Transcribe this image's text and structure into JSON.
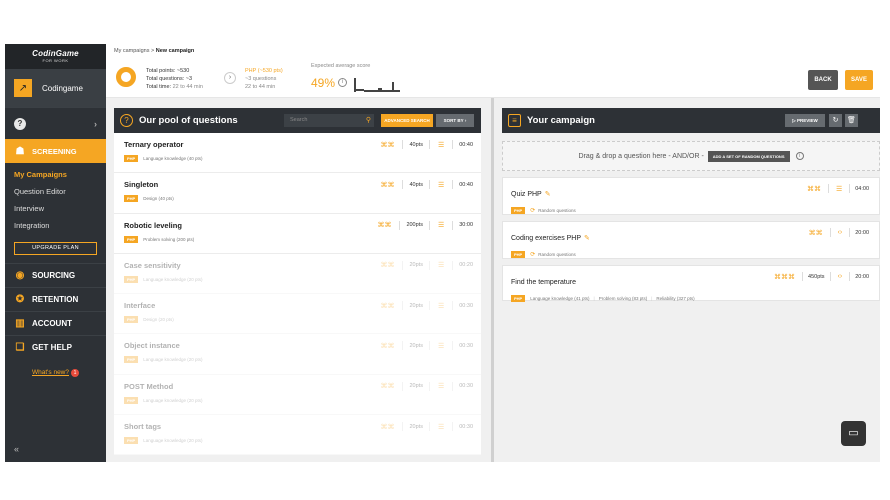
{
  "sidebar": {
    "logo": "CodinGame",
    "logo_sub": "FOR WORK",
    "account_name": "Codingame",
    "screening_label": "SCREENING",
    "sub_items": [
      "My Campaigns",
      "Question Editor",
      "Interview",
      "Integration"
    ],
    "upgrade_label": "UPGRADE PLAN",
    "sections": [
      "SOURCING",
      "RETENTION",
      "ACCOUNT",
      "GET HELP"
    ],
    "whats_new": "What's new?",
    "whats_new_count": "1",
    "collapse": "«"
  },
  "header": {
    "breadcrumb_root": "My campaigns",
    "breadcrumb_sep": ">",
    "breadcrumb_current": "New campaign",
    "total_points": "Total points: ~530",
    "total_questions": "Total questions: ~3",
    "total_time_label": "Total time:",
    "total_time_value": "22 to 44 min",
    "php_points": "PHP (~530 pts)",
    "php_questions": "~3 questions",
    "php_time": "22 to 44 min",
    "expected_label": "Expected average score",
    "expected_score": "49%",
    "back_label": "BACK",
    "save_label": "SAVE"
  },
  "pool": {
    "title": "Our pool of questions",
    "search_placeholder": "Search",
    "advanced_label": "ADVANCED SEARCH",
    "sort_label": "SORT BY",
    "questions": [
      {
        "title": "Ternary operator",
        "tag": "PHP",
        "category": "Language knowledge (40 pts)",
        "points": "40pts",
        "time": "00:40",
        "dim": false
      },
      {
        "title": "Singleton",
        "tag": "PHP",
        "category": "Design (40 pts)",
        "points": "40pts",
        "time": "00:40",
        "dim": false
      },
      {
        "title": "Robotic leveling",
        "tag": "PHP",
        "category": "Problem solving (200 pts)",
        "points": "200pts",
        "time": "30:00",
        "dim": false
      },
      {
        "title": "Case sensitivity",
        "tag": "PHP",
        "category": "Language knowledge (20 pts)",
        "points": "20pts",
        "time": "00:20",
        "dim": true
      },
      {
        "title": "Interface",
        "tag": "PHP",
        "category": "Design (20 pts)",
        "points": "20pts",
        "time": "00:30",
        "dim": true
      },
      {
        "title": "Object instance",
        "tag": "PHP",
        "category": "Language knowledge (20 pts)",
        "points": "20pts",
        "time": "00:30",
        "dim": true
      },
      {
        "title": "POST Method",
        "tag": "PHP",
        "category": "Language knowledge (20 pts)",
        "points": "20pts",
        "time": "00:30",
        "dim": true
      },
      {
        "title": "Short tags",
        "tag": "PHP",
        "category": "Language knowledge (20 pts)",
        "points": "20pts",
        "time": "00:30",
        "dim": true
      }
    ]
  },
  "campaign": {
    "title": "Your campaign",
    "preview_label": "PREVIEW",
    "dropzone_text": "Drag & drop a question here - AND/OR -",
    "random_label": "ADD A SET OF RANDOM QUESTIONS",
    "items": [
      {
        "title": "Quiz PHP",
        "tag": "PHP",
        "detail": "Random questions",
        "time": "04:00"
      },
      {
        "title": "Coding exercises PHP",
        "tag": "PHP",
        "detail": "Random questions",
        "time": "20:00"
      },
      {
        "title": "Find the temperature",
        "tag": "PHP",
        "detail_a": "Language knowledge (41 pts)",
        "detail_b": "Problem solving (83 pts)",
        "detail_c": "Reliability (327 pts)",
        "points": "450pts",
        "time": "20:00"
      }
    ]
  },
  "colors": {
    "accent": "#f5a623",
    "sidebar": "#2d3136"
  }
}
